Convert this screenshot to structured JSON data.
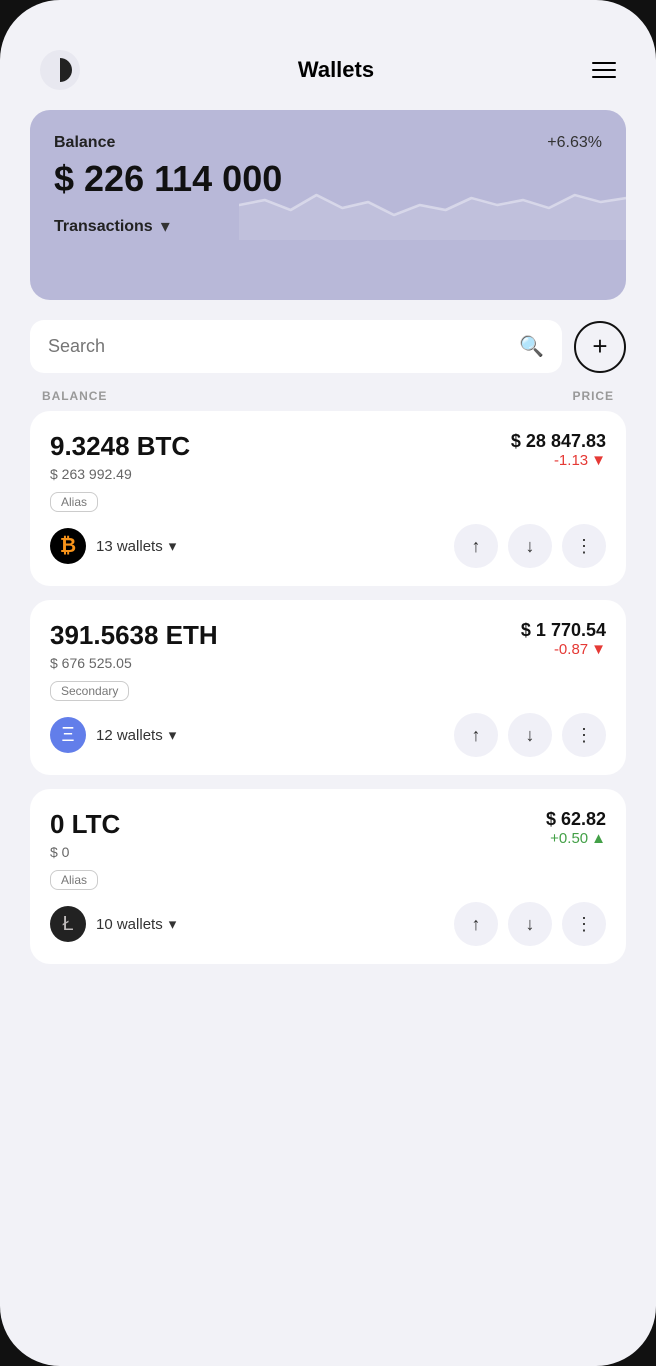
{
  "header": {
    "title": "Wallets",
    "menu_label": "menu"
  },
  "balance_card": {
    "label": "Balance",
    "percent": "+6.63%",
    "amount": "$ 226 114 000",
    "transactions_label": "Transactions"
  },
  "search": {
    "placeholder": "Search",
    "add_label": "+"
  },
  "table_headers": {
    "balance": "BALANCE",
    "price": "PRICE"
  },
  "coins": [
    {
      "amount": "9.3248 BTC",
      "usd": "$ 263 992.49",
      "alias": "Alias",
      "wallets": "13 wallets",
      "price": "$ 28 847.83",
      "change": "-1.13",
      "change_dir": "neg",
      "symbol": "₿"
    },
    {
      "amount": "391.5638 ETH",
      "usd": "$ 676 525.05",
      "alias": "Secondary",
      "wallets": "12 wallets",
      "price": "$ 1 770.54",
      "change": "-0.87",
      "change_dir": "neg",
      "symbol": "Ξ"
    },
    {
      "amount": "0 LTC",
      "usd": "$ 0",
      "alias": "Alias",
      "wallets": "10 wallets",
      "price": "$ 62.82",
      "change": "+0.50",
      "change_dir": "pos",
      "symbol": "Ł"
    }
  ]
}
